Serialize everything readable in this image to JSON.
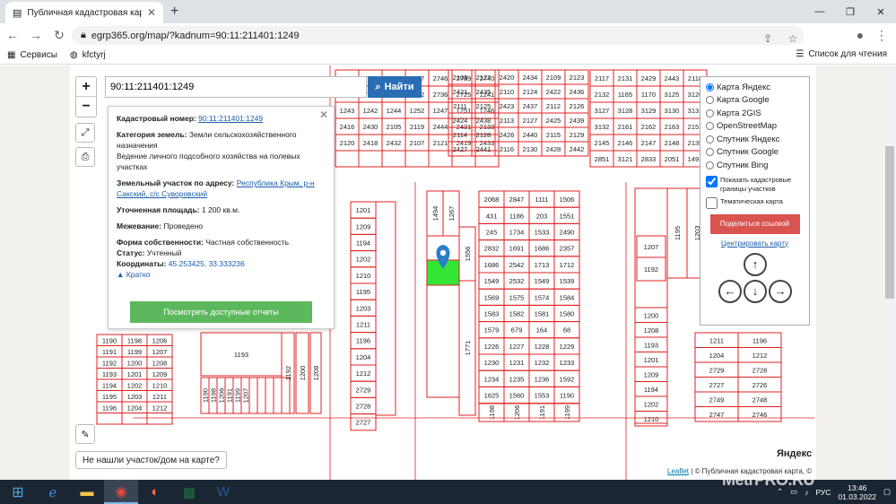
{
  "browser": {
    "tab_title": "Публичная кадастровая карта - ",
    "url": "egrp365.org/map/?kadnum=90:11:211401:1249",
    "bookmarks": [
      "Сервисы",
      "kfctyrj"
    ],
    "reading_list": "Список для чтения"
  },
  "map": {
    "search_value": "90:11:211401:1249",
    "search_button": "Найти",
    "zoom_in": "+",
    "zoom_out": "−",
    "not_found": "Не нашли участок/дом на карте?",
    "leaflet_prefix": "Leaflet",
    "leaflet_attrib": "© Публичная кадастровая карта, ©",
    "yandex_logo": "Яндекс",
    "parcel_numbers": [
      "1190",
      "1198",
      "1206",
      "1191",
      "1199",
      "1207",
      "1192",
      "1200",
      "1208",
      "1193",
      "1201",
      "1209",
      "1194",
      "1202",
      "1210",
      "1195",
      "1203",
      "1211",
      "1196",
      "1204",
      "1212",
      "2729",
      "2728",
      "2727",
      "2726",
      "2749",
      "2748",
      "2747",
      "2746",
      "2739",
      "2740",
      "2743",
      "2741",
      "2744",
      "2742",
      "2736",
      "2725",
      "1241",
      "1243",
      "1242",
      "1244",
      "1252",
      "1247",
      "1251",
      "1246",
      "2416",
      "2430",
      "2105",
      "2119",
      "2444",
      "2431",
      "2133",
      "2120",
      "2418",
      "2432",
      "2107",
      "2121",
      "2419",
      "2433",
      "2108",
      "2122",
      "2420",
      "2434",
      "2109",
      "2123",
      "2421",
      "2435",
      "2110",
      "2124",
      "2422",
      "2436",
      "2111",
      "2125",
      "2423",
      "2437",
      "2112",
      "2126",
      "2424",
      "2438",
      "2113",
      "2127",
      "2425",
      "2439",
      "2114",
      "2128",
      "2426",
      "2440",
      "2115",
      "2129",
      "2427",
      "2441",
      "2116",
      "2130",
      "2428",
      "2442",
      "2117",
      "2131",
      "2429",
      "2443",
      "2118",
      "2132",
      "1165",
      "1170",
      "3125",
      "3126",
      "3127",
      "3128",
      "3129",
      "3130",
      "3131",
      "3132",
      "2161",
      "2162",
      "2163",
      "2151",
      "2145",
      "2146",
      "2147",
      "2148",
      "2135",
      "2851",
      "3121",
      "2833",
      "2051",
      "1491",
      "1494",
      "1267",
      "1556",
      "1771",
      "2068",
      "2847",
      "1111",
      "1506",
      "431",
      "1186",
      "203",
      "1551",
      "245",
      "1734",
      "1533",
      "2490",
      "2832",
      "1691",
      "1686",
      "2357",
      "1686",
      "2542",
      "1713",
      "1712",
      "1549",
      "2532",
      "1549",
      "1539",
      "1569",
      "1575",
      "1574",
      "1584",
      "1583",
      "1582",
      "1581",
      "1580",
      "1579",
      "679",
      "164",
      "68",
      "1226",
      "1227",
      "1228",
      "1229",
      "1230",
      "1231",
      "1232",
      "1233",
      "1234",
      "1235",
      "1236",
      "1592",
      "1625",
      "1560",
      "1553"
    ],
    "sample_labels": [
      {
        "t": "1190"
      },
      {
        "t": "1198"
      },
      {
        "t": "1206"
      },
      {
        "t": "1191"
      },
      {
        "t": "1199"
      },
      {
        "t": "1207"
      },
      {
        "t": "1192"
      },
      {
        "t": "1200"
      },
      {
        "t": "1208"
      },
      {
        "t": "1193"
      },
      {
        "t": "1201"
      },
      {
        "t": "1209"
      },
      {
        "t": "1194"
      },
      {
        "t": "1202"
      },
      {
        "t": "1210"
      },
      {
        "t": "1195"
      },
      {
        "t": "1203"
      },
      {
        "t": "1211"
      },
      {
        "t": "1196"
      },
      {
        "t": "1204"
      },
      {
        "t": "1212"
      }
    ]
  },
  "info": {
    "cad_label": "Кадастровый номер:",
    "cad_value": "90:11:211401:1249",
    "cat_label": "Категория земель:",
    "cat_value": "Земли сельскохозяйственного назначения",
    "use_value": "Ведение личного подсобного хозяйства на полевых участках",
    "addr_label": "Земельный участок по адресу:",
    "addr_value": "Республика Крым, р-н Сакский, с/с Суворовский",
    "area_label": "Уточненная площадь:",
    "area_value": "1 200 кв.м.",
    "survey_label": "Межевание:",
    "survey_value": "Проведено",
    "own_label": "Форма собственности:",
    "own_value": "Частная собственность",
    "status_label": "Статус:",
    "status_value": "Учтенный",
    "coord_label": "Координаты:",
    "coord_value": "45.253425, 33.333236",
    "brief": "Кратко",
    "reports_button": "Посмотреть доступные отчеты"
  },
  "layers": {
    "options": [
      "Карта Яндекс",
      "Карта Google",
      "Карта 2GIS",
      "OpenStreetMap",
      "Спутник Яндекс",
      "Спутник Google",
      "Спутник Bing"
    ],
    "selected": "Карта Яндекс",
    "show_borders": "Показать кадастровые границы участков",
    "thematic": "Тематическая карта",
    "share": "Поделиться ссылкой",
    "center": "Центрировать карту"
  },
  "taskbar": {
    "time": "13:46",
    "date": "01.03.2022",
    "lang": "РУС",
    "watermark": "MetrPRO.RU"
  },
  "colors": {
    "parcel_border": "#e02020",
    "highlight": "#33e633",
    "search_button": "#2a6db5",
    "reports_button": "#5cb85c",
    "share_button": "#d9534f"
  }
}
